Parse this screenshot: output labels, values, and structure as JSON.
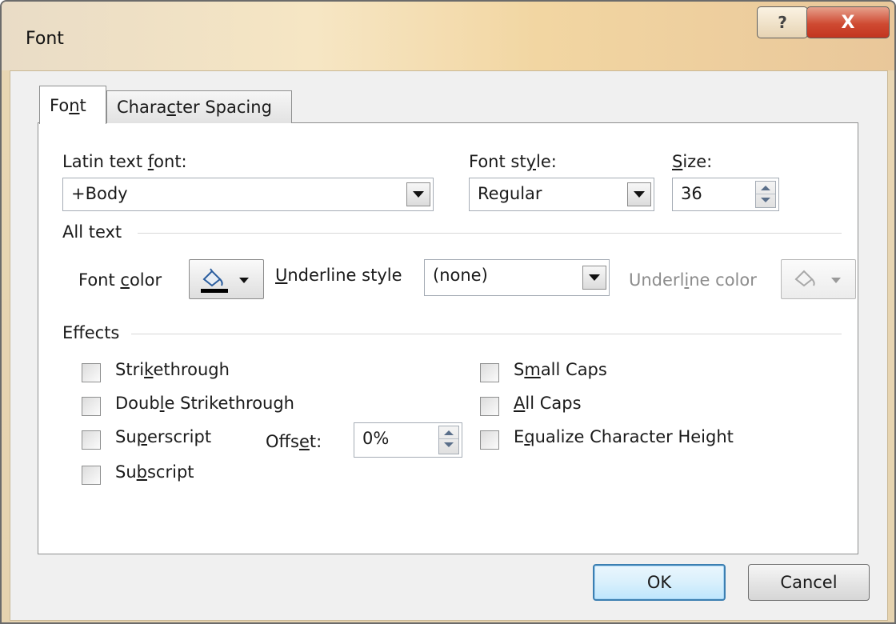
{
  "window": {
    "title": "Font",
    "help_glyph": "?",
    "close_glyph": "X"
  },
  "tabs": [
    {
      "label_pre": "Fo",
      "label_ul": "n",
      "label_post": "t"
    },
    {
      "label_pre": "Chara",
      "label_ul": "c",
      "label_post": "ter Spacing"
    }
  ],
  "font_section": {
    "latin_label_pre": "Latin text ",
    "latin_label_ul": "f",
    "latin_label_post": "ont:",
    "latin_value": "+Body",
    "style_label_pre": "Font st",
    "style_label_ul": "y",
    "style_label_post": "le:",
    "style_value": "Regular",
    "size_label_ul": "S",
    "size_label_post": "ize:",
    "size_value": "36"
  },
  "all_text": {
    "heading": "All text",
    "font_color_label_pre": "Font ",
    "font_color_label_ul": "c",
    "font_color_label_post": "olor",
    "underline_style_label_ul": "U",
    "underline_style_label_post": "nderline style",
    "underline_style_value": "(none)",
    "underline_color_label_pre": "Underl",
    "underline_color_label_ul": "i",
    "underline_color_label_post": "ne color",
    "font_color_swatch": "#000000"
  },
  "effects": {
    "heading": "Effects",
    "left": [
      {
        "pre": "Stri",
        "ul": "k",
        "post": "ethrough",
        "checked": false
      },
      {
        "pre": "Doub",
        "ul": "l",
        "post": "e Strikethrough",
        "checked": false
      },
      {
        "pre": "Su",
        "ul": "p",
        "post": "erscript",
        "checked": false
      },
      {
        "pre": "Su",
        "ul": "b",
        "post": "script",
        "checked": false
      }
    ],
    "right": [
      {
        "pre": "S",
        "ul": "m",
        "post": "all Caps",
        "checked": false
      },
      {
        "pre": "",
        "ul": "A",
        "post": "ll Caps",
        "checked": false
      },
      {
        "pre": "E",
        "ul": "q",
        "post": "ualize Character Height",
        "checked": false
      }
    ],
    "offset_label_pre": "Offs",
    "offset_label_ul": "e",
    "offset_label_post": "t:",
    "offset_value": "0%"
  },
  "buttons": {
    "ok": "OK",
    "cancel": "Cancel"
  }
}
